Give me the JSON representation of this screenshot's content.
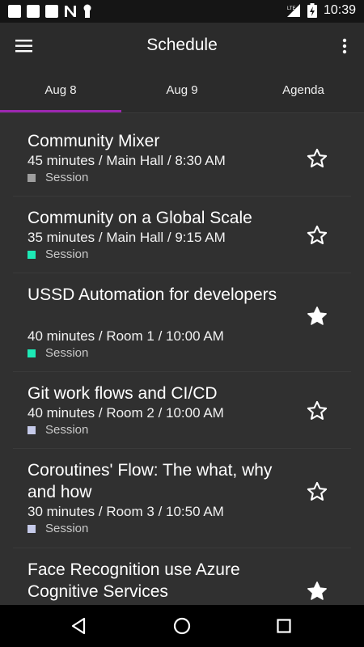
{
  "status_bar": {
    "time": "10:39",
    "network": "LTE",
    "icons": [
      "notification-icon",
      "notification-icon",
      "notification-icon",
      "n-icon",
      "keyhole-icon",
      "signal-icon",
      "battery-charging-icon"
    ]
  },
  "app_bar": {
    "title": "Schedule",
    "menu_icon": "hamburger-icon",
    "more_icon": "more-vert-icon"
  },
  "tabs": [
    {
      "label": "Aug 8",
      "selected": true
    },
    {
      "label": "Aug 9",
      "selected": false
    },
    {
      "label": "Agenda",
      "selected": false
    }
  ],
  "accent_color": "#9c27b0",
  "sessions": [
    {
      "title": "Community Mixer",
      "meta": "45 minutes / Main Hall / 8:30 AM",
      "type": "Session",
      "type_color": "#9e9e9e",
      "starred": false
    },
    {
      "title": "Community on a Global Scale",
      "meta": "35 minutes / Main Hall / 9:15 AM",
      "type": "Session",
      "type_color": "#1de9b6",
      "starred": false
    },
    {
      "title": "USSD Automation for developers",
      "meta": "40 minutes / Room 1 / 10:00 AM",
      "type": "Session",
      "type_color": "#1de9b6",
      "starred": true
    },
    {
      "title": "Git work flows and CI/CD",
      "meta": "40 minutes / Room 2 / 10:00 AM",
      "type": "Session",
      "type_color": "#c5cae9",
      "starred": false
    },
    {
      "title": "Coroutines' Flow: The what, why and how",
      "meta": "30 minutes / Room 3 / 10:50 AM",
      "type": "Session",
      "type_color": "#c5cae9",
      "starred": false
    },
    {
      "title": "Face Recognition use Azure Cognitive Services",
      "meta": "",
      "type": "",
      "type_color": "#c5cae9",
      "starred": true
    }
  ],
  "nav_bar": {
    "icons": [
      "back-icon",
      "home-icon",
      "recents-icon"
    ]
  }
}
